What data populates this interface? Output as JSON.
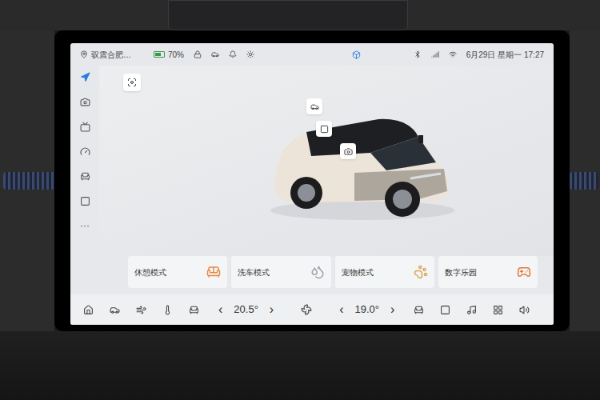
{
  "status_bar": {
    "location": "驭震合肥…",
    "battery": {
      "level": 0.7,
      "reading": "70%"
    },
    "datetime": "6月29日 星期一 17:27"
  },
  "sidebar": {
    "items": [
      {
        "kind": "icon",
        "selected": true
      },
      {
        "kind": "icon",
        "selected": false
      },
      {
        "kind": "icon",
        "selected": false
      },
      {
        "kind": "icon",
        "selected": false
      },
      {
        "kind": "icon",
        "selected": false
      },
      {
        "kind": "icon",
        "selected": false
      },
      {
        "kind": "text",
        "label": "···",
        "selected": false
      }
    ]
  },
  "modes": [
    {
      "label": "休憩模式"
    },
    {
      "label": "洗车模式"
    },
    {
      "label": "宠物模式"
    },
    {
      "label": "数字乐园"
    }
  ],
  "climate": {
    "driver": {
      "decrease": "‹",
      "temperature": "20.5°",
      "increase": "›"
    },
    "passenger": {
      "decrease": "‹",
      "temperature": "19.0°",
      "increase": "›"
    }
  }
}
